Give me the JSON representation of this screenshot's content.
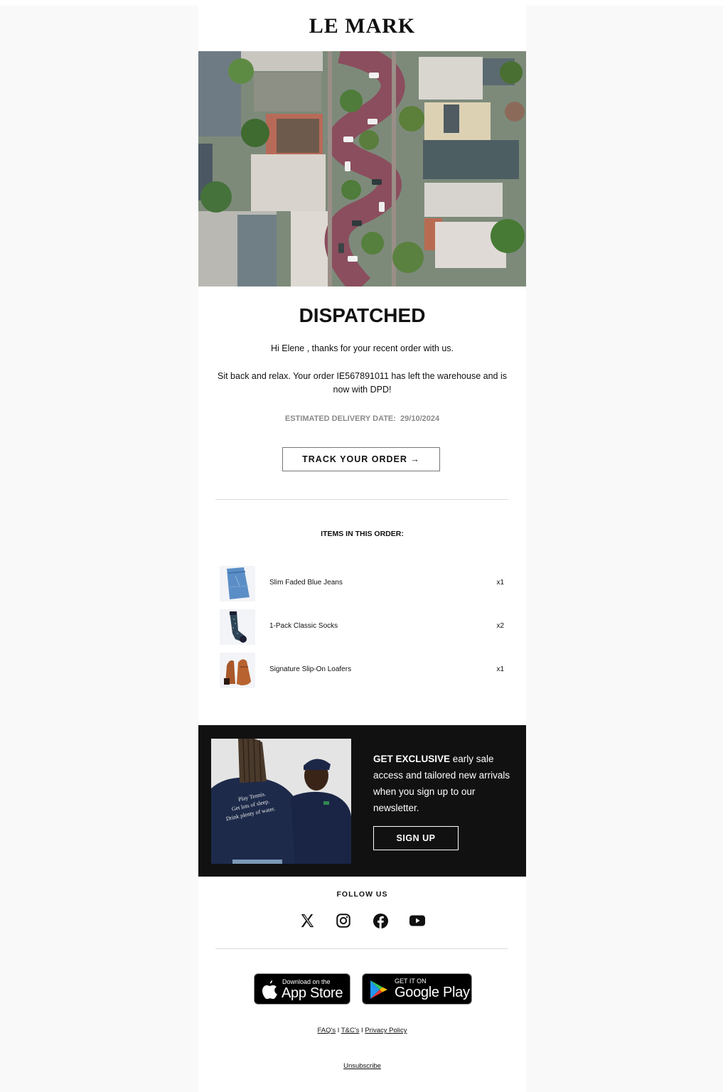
{
  "brand": {
    "logo": "LE MARK"
  },
  "hero": {
    "image": "aerial-view-winding-street"
  },
  "dispatch": {
    "title": "DISPATCHED",
    "greeting": "Hi Elene , thanks for your recent order with us.",
    "message": "Sit back and relax. Your order IE567891011 has left the warehouse and is now with DPD!",
    "eta_label": "ESTIMATED DELIVERY DATE:",
    "eta_value": "29/10/2024",
    "track_button": "TRACK YOUR ORDER →"
  },
  "order": {
    "title": "ITEMS IN THIS ORDER:",
    "items": [
      {
        "name": "Slim Faded Blue Jeans",
        "qty": "x1",
        "image": "jeans"
      },
      {
        "name": "1-Pack Classic Socks",
        "qty": "x2",
        "image": "socks"
      },
      {
        "name": "Signature Slip-On Loafers",
        "qty": "x1",
        "image": "loafers"
      }
    ]
  },
  "promo": {
    "bold": "GET EXCLUSIVE",
    "text": " early sale access and tailored new arrivals when you sign up to our newsletter.",
    "button": "SIGN UP",
    "image_caption": "Play Tennis. Get lots of sleep. Drink plenty of water.",
    "colors": {
      "background": "#111111"
    }
  },
  "social": {
    "title": "FOLLOW US",
    "icons": [
      "x-icon",
      "instagram-icon",
      "facebook-icon",
      "youtube-icon"
    ]
  },
  "apps": {
    "apple": {
      "small": "Download on the",
      "big": "App Store"
    },
    "google": {
      "small": "GET IT ON",
      "big": "Google Play"
    }
  },
  "footer": {
    "links": [
      "FAQ's",
      "T&C's",
      "Privacy Policy"
    ],
    "separator": " I ",
    "unsubscribe": "Unsubscribe"
  }
}
